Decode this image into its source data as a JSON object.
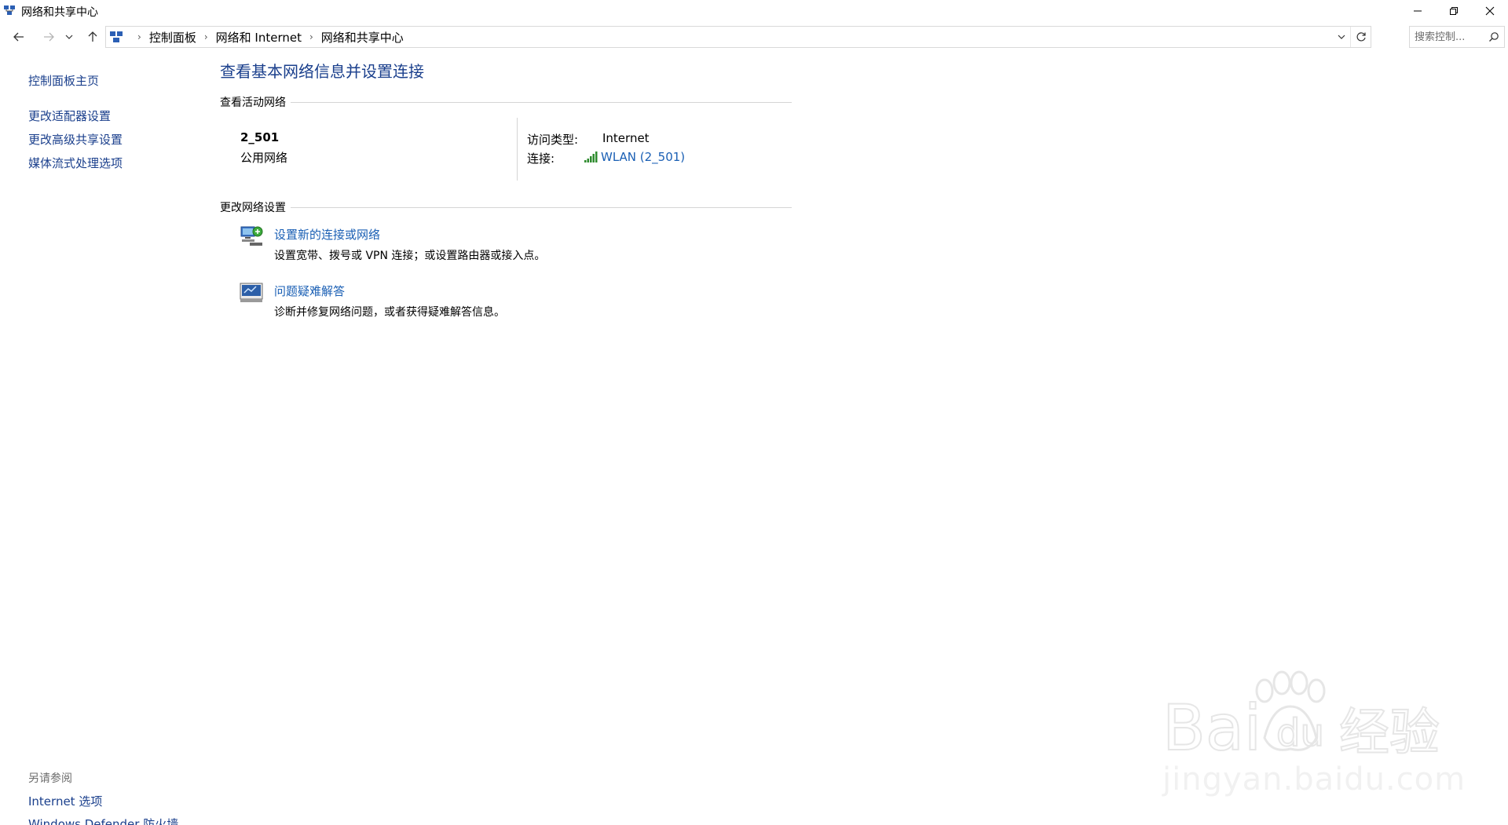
{
  "window": {
    "title": "网络和共享中心",
    "controls": {
      "minimize_icon": "minimize-icon",
      "maximize_icon": "restore-icon",
      "close_icon": "close-icon"
    }
  },
  "nav": {
    "back_icon": "arrow-left-icon",
    "forward_icon": "arrow-right-icon",
    "recent_icon": "chevron-down-icon",
    "up_icon": "arrow-up-icon"
  },
  "address": {
    "crumbs": [
      "控制面板",
      "网络和 Internet",
      "网络和共享中心"
    ],
    "separator": "›"
  },
  "search": {
    "placeholder": "搜索控制..."
  },
  "sidebar": {
    "items": [
      {
        "label": "控制面板主页"
      },
      {
        "label": "更改适配器设置"
      },
      {
        "label": "更改高级共享设置"
      },
      {
        "label": "媒体流式处理选项"
      }
    ],
    "see_also": {
      "heading": "另请参阅",
      "items": [
        {
          "label": "Internet 选项"
        },
        {
          "label": "Windows Defender 防火墙"
        }
      ]
    }
  },
  "main": {
    "title": "查看基本网络信息并设置连接",
    "active_networks": {
      "heading": "查看活动网络",
      "network_name": "2_501",
      "network_type": "公用网络",
      "access_type_label": "访问类型:",
      "access_type_value": "Internet",
      "connections_label": "连接:",
      "connection_value": "WLAN (2_501)"
    },
    "change_settings": {
      "heading": "更改网络设置",
      "tasks": [
        {
          "link": "设置新的连接或网络",
          "desc": "设置宽带、拨号或 VPN 连接；或设置路由器或接入点。",
          "icon": "new-connection-icon"
        },
        {
          "link": "问题疑难解答",
          "desc": "诊断并修复网络问题，或者获得疑难解答信息。",
          "icon": "troubleshoot-icon"
        }
      ]
    }
  },
  "watermark": {
    "logo_text": "Bai du 经验",
    "url": "jingyan.baidu.com"
  },
  "colors": {
    "link": "#1a5fb4",
    "title": "#1a3f8c",
    "rule": "#d5d5d5"
  }
}
